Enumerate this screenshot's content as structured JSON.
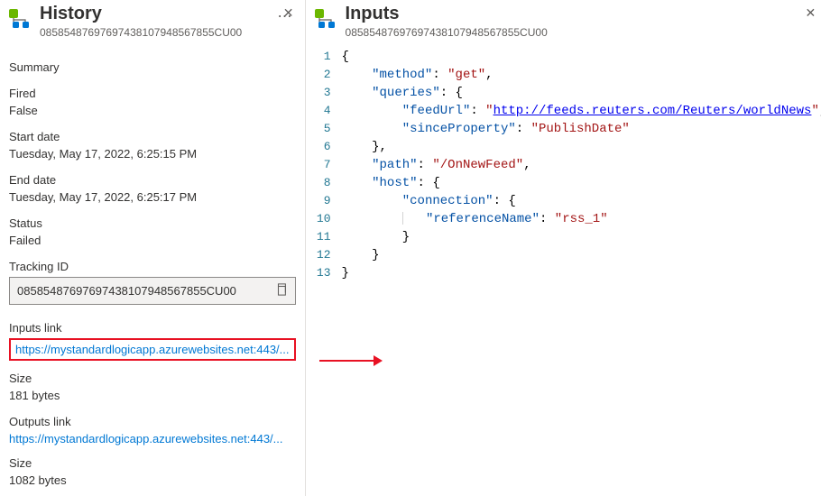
{
  "historyPanel": {
    "title": "History",
    "subtitle": "08585487697697438107948567855CU00",
    "summaryLabel": "Summary",
    "firedLabel": "Fired",
    "firedValue": "False",
    "startDateLabel": "Start date",
    "startDateValue": "Tuesday, May 17, 2022, 6:25:15 PM",
    "endDateLabel": "End date",
    "endDateValue": "Tuesday, May 17, 2022, 6:25:17 PM",
    "statusLabel": "Status",
    "statusValue": "Failed",
    "trackingIdLabel": "Tracking ID",
    "trackingIdValue": "08585487697697438107948567855CU00",
    "inputsLinkLabel": "Inputs link",
    "inputsLinkValue": "https://mystandardlogicapp.azurewebsites.net:443/...",
    "sizeLabel1": "Size",
    "sizeValue1": "181 bytes",
    "outputsLinkLabel": "Outputs link",
    "outputsLinkValue": "https://mystandardlogicapp.azurewebsites.net:443/...",
    "sizeLabel2": "Size",
    "sizeValue2": "1082 bytes"
  },
  "inputsPanel": {
    "title": "Inputs",
    "subtitle": "08585487697697438107948567855CU00",
    "code": {
      "method": "get",
      "queries": {
        "feedUrl": "http://feeds.reuters.com/Reuters/worldNews",
        "sinceProperty": "PublishDate"
      },
      "path": "/OnNewFeed",
      "host": {
        "connection": {
          "referenceName": "rss_1"
        }
      }
    }
  }
}
